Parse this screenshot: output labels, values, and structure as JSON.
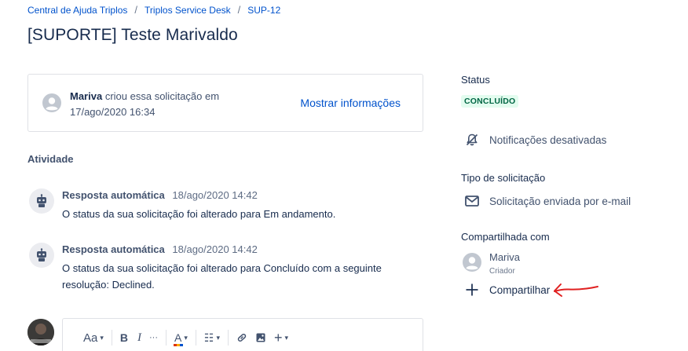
{
  "breadcrumb": {
    "items": [
      "Central de Ajuda Triplos",
      "Triplos Service Desk",
      "SUP-12"
    ],
    "separator": "/"
  },
  "request": {
    "title": "[SUPORTE] Teste Marivaldo",
    "creator": "Mariva",
    "created_text": "criou essa solicitação em 17/ago/2020 16:34",
    "show_info_label": "Mostrar informações"
  },
  "activity": {
    "heading": "Atividade",
    "items": [
      {
        "author": "Resposta automática",
        "date": "18/ago/2020 14:42",
        "body": "O status da sua solicitação foi alterado para Em andamento."
      },
      {
        "author": "Resposta automática",
        "date": "18/ago/2020 14:42",
        "body": "O status da sua solicitação foi alterado para Concluído com a seguinte resolução: Declined."
      }
    ]
  },
  "composer": {
    "toolbar": {
      "text_style": "Aa",
      "bold": "B",
      "italic": "I",
      "more": "···",
      "color": "A",
      "list": "☷",
      "link": "🔗",
      "image": "▣",
      "insert": "+"
    }
  },
  "sidebar": {
    "status_label": "Status",
    "status_value": "CONCLUÍDO",
    "notifications_label": "Notificações desativadas",
    "request_type_label": "Tipo de solicitação",
    "request_type_value": "Solicitação enviada por e-mail",
    "shared_with_label": "Compartilhada com",
    "shared_user_name": "Mariva",
    "shared_user_role": "Criador",
    "share_label": "Compartilhar"
  },
  "colors": {
    "link": "#0052cc",
    "status_bg": "#e3fcef",
    "status_text": "#006644",
    "annotation_arrow": "#e02020"
  },
  "icons": [
    "user-avatar-icon",
    "bot-avatar-icon",
    "bell-off-icon",
    "envelope-icon",
    "plus-icon"
  ]
}
